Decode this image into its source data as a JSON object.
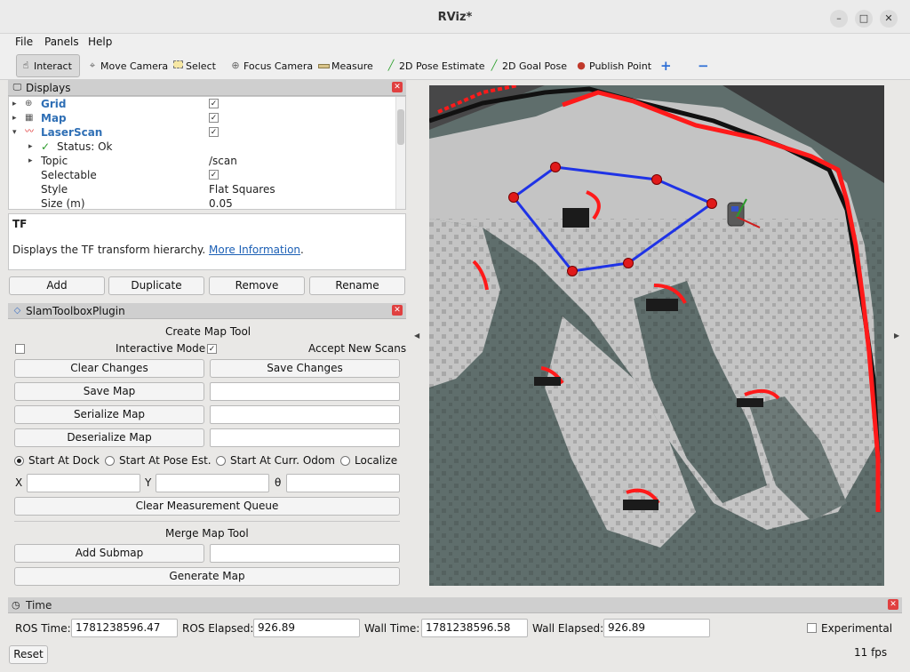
{
  "window": {
    "title": "RViz*",
    "minimize": "–",
    "maximize": "□",
    "close": "✕"
  },
  "menu": {
    "file": "File",
    "panels": "Panels",
    "help": "Help"
  },
  "toolbar": {
    "interact": "Interact",
    "move_camera": "Move Camera",
    "select": "Select",
    "focus_camera": "Focus Camera",
    "measure": "Measure",
    "pose_estimate": "2D Pose Estimate",
    "goal_pose": "2D Goal Pose",
    "publish_point": "Publish Point",
    "plus": "+",
    "minus": "−"
  },
  "displays": {
    "title": "Displays",
    "items": [
      {
        "label": "Grid",
        "checked": "✓"
      },
      {
        "label": "Map",
        "checked": "✓"
      },
      {
        "label": "LaserScan",
        "checked": "✓"
      }
    ],
    "status": "Status: Ok",
    "props": [
      {
        "label": "Topic",
        "value": "/scan"
      },
      {
        "label": "Selectable",
        "value": "✓"
      },
      {
        "label": "Style",
        "value": "Flat Squares"
      },
      {
        "label": "Size (m)",
        "value": "0.05"
      }
    ],
    "desc_title": "TF",
    "desc_text": "Displays the TF transform hierarchy. ",
    "desc_link": "More Information",
    "desc_end": ".",
    "buttons": {
      "add": "Add",
      "duplicate": "Duplicate",
      "remove": "Remove",
      "rename": "Rename"
    }
  },
  "slam": {
    "title": "SlamToolboxPlugin",
    "create_heading": "Create Map Tool",
    "interactive_mode": "Interactive Mode",
    "accept_new_scans": "Accept New Scans",
    "clear_changes": "Clear Changes",
    "save_changes": "Save Changes",
    "save_map": "Save Map",
    "serialize_map": "Serialize Map",
    "deserialize_map": "Deserialize Map",
    "start_at_dock": "Start At Dock",
    "start_at_pose": "Start At Pose Est.",
    "start_at_odom": "Start At Curr. Odom",
    "localize": "Localize",
    "x_label": "X",
    "y_label": "Y",
    "theta_label": "θ",
    "clear_queue": "Clear Measurement Queue",
    "merge_heading": "Merge Map Tool",
    "add_submap": "Add Submap",
    "generate_map": "Generate Map"
  },
  "time": {
    "title": "Time",
    "ros_time_label": "ROS Time:",
    "ros_time": "1781238596.47",
    "ros_elapsed_label": "ROS Elapsed:",
    "ros_elapsed": "926.89",
    "wall_time_label": "Wall Time:",
    "wall_time": "1781238596.58",
    "wall_elapsed_label": "Wall Elapsed:",
    "wall_elapsed": "926.89",
    "experimental": "Experimental",
    "reset": "Reset",
    "fps": "11 fps"
  },
  "colors": {
    "scan": "#ff1a1a",
    "polygon": "#1f33e6",
    "free_space": "#c4c4c4",
    "unknown": "#5f6e6c"
  }
}
